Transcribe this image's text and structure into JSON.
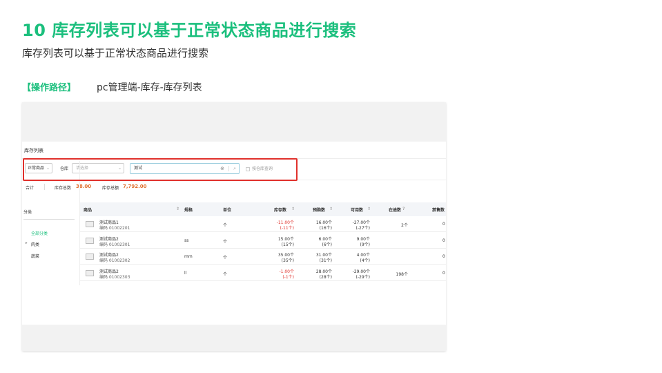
{
  "slide": {
    "title": "10  库存列表可以基于正常状态商品进行搜索",
    "subtitle": "库存列表可以基于正常状态商品进行搜索",
    "path_label": "【操作路径】",
    "path_value": "pc管理端-库存-库存列表"
  },
  "page": {
    "title": "库存列表",
    "status_select": "正常商品",
    "warehouse_label": "仓库",
    "warehouse_placeholder": "请选择",
    "search_value": "测试",
    "checkbox_label": "按仓库查询"
  },
  "summary": {
    "total_label": "合计",
    "qty_label": "库存总数",
    "qty_value": "38.00",
    "amount_label": "库存总额",
    "amount_value": "7,792.00"
  },
  "tree": {
    "title": "分类",
    "items": [
      "全部分类",
      "肉类",
      "蔬菜"
    ]
  },
  "table": {
    "headers": [
      "商品",
      "规格",
      "单位",
      "库存数",
      "预购数",
      "可用数",
      "在途数",
      "禁售数"
    ],
    "rows": [
      {
        "name": "测试商品1",
        "code": "编码  01002201",
        "spec": "",
        "unit": "个",
        "stock": "-11.00个",
        "stock_sub": "(-11个)",
        "pre": "16.00个",
        "pre_sub": "(16个)",
        "avail": "-27.00个",
        "avail_sub": "(-27个)",
        "transit": "2个",
        "ban": "0",
        "stock_neg": true
      },
      {
        "name": "测试商品2",
        "code": "编码  01002301",
        "spec": "ss",
        "unit": "个",
        "stock": "15.00个",
        "stock_sub": "(15个)",
        "pre": "6.00个",
        "pre_sub": "(6个)",
        "avail": "9.00个",
        "avail_sub": "(9个)",
        "transit": "",
        "ban": "0",
        "stock_neg": false
      },
      {
        "name": "测试商品2",
        "code": "编码  01002302",
        "spec": "mm",
        "unit": "个",
        "stock": "35.00个",
        "stock_sub": "(35个)",
        "pre": "31.00个",
        "pre_sub": "(31个)",
        "avail": "4.00个",
        "avail_sub": "(4个)",
        "transit": "",
        "ban": "0",
        "stock_neg": false
      },
      {
        "name": "测试商品2",
        "code": "编码  01002303",
        "spec": "ll",
        "unit": "个",
        "stock": "-1.00个",
        "stock_sub": "(-1个)",
        "pre": "28.00个",
        "pre_sub": "(28个)",
        "avail": "-29.00个",
        "avail_sub": "(-29个)",
        "transit": "198个",
        "ban": "0",
        "stock_neg": true
      }
    ]
  },
  "colors": {
    "accent": "#1bbf7d",
    "alert": "#e0302b",
    "highlight_box": "#e0302b"
  }
}
